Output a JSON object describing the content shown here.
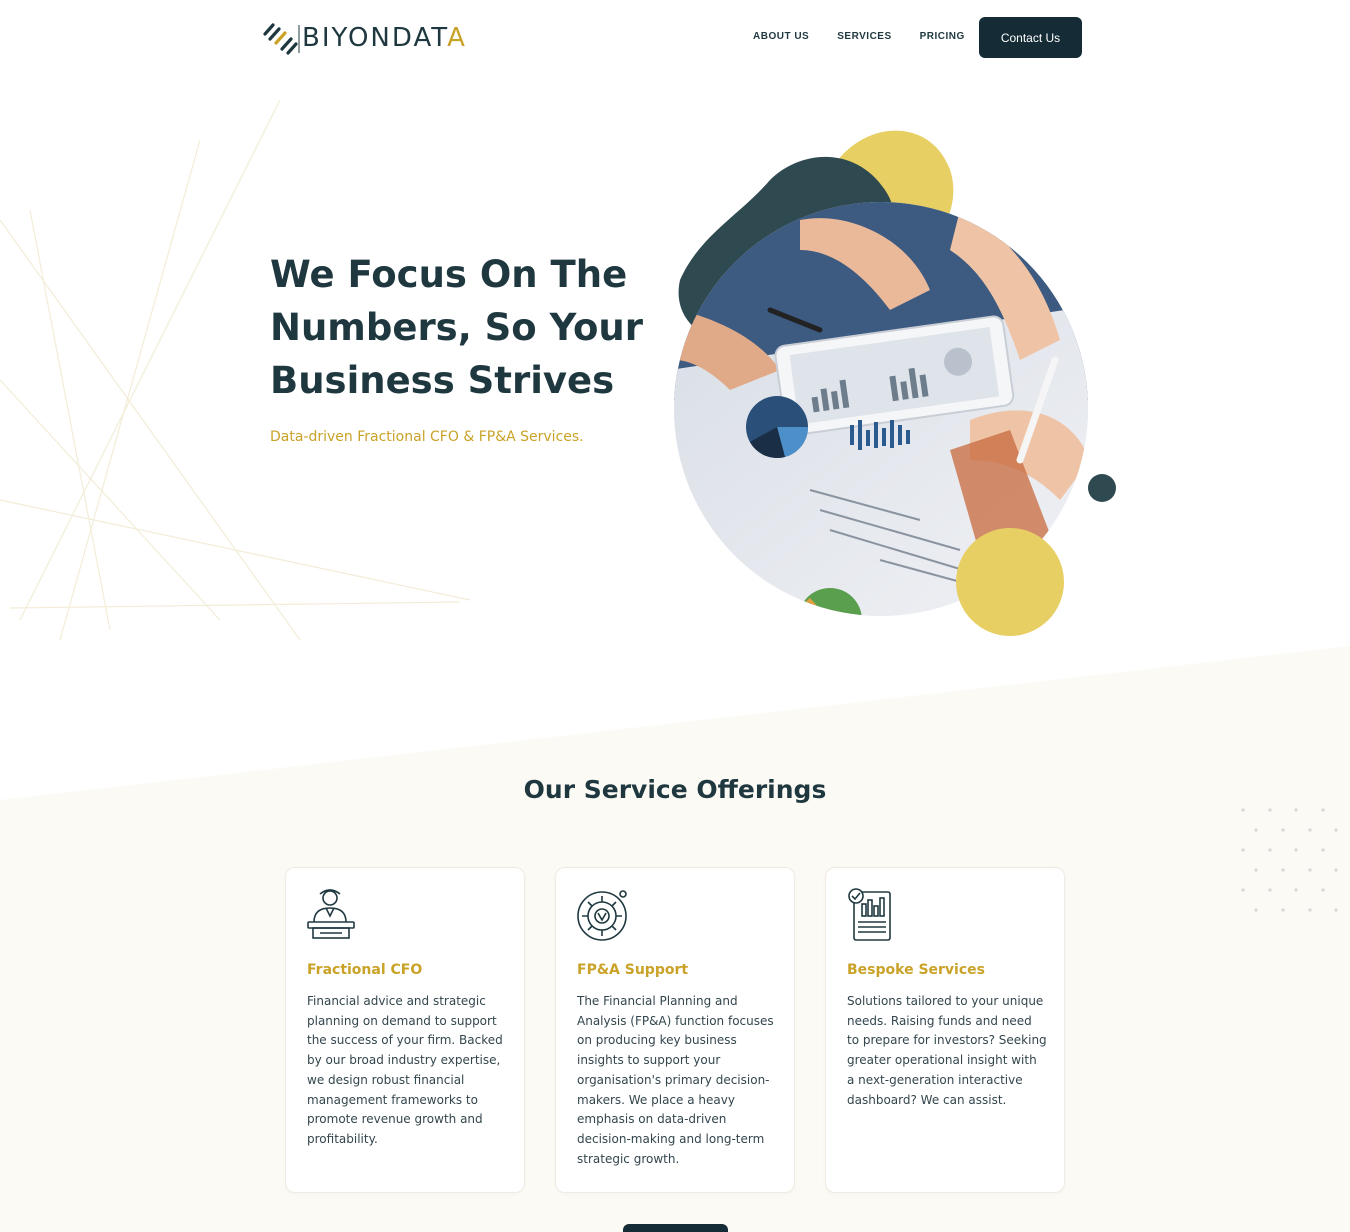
{
  "header": {
    "logo_text": "BIYONDATA",
    "nav": [
      "ABOUT US",
      "SERVICES",
      "PRICING"
    ],
    "contact_label": "Contact Us"
  },
  "hero": {
    "title_lines": [
      "We Focus On The",
      "Numbers, So Your",
      "Business Strives"
    ],
    "subtitle": "Data-driven Fractional CFO & FP&A Services."
  },
  "offerings": {
    "title": "Our Service Offerings",
    "cards": [
      {
        "icon": "presenter-icon",
        "title": "Fractional CFO",
        "desc": "Financial advice and strategic planning on demand to support the success of your firm. Backed by our broad industry expertise, we design robust financial management frameworks to promote revenue growth and profitability."
      },
      {
        "icon": "gear-icon",
        "title": "FP&A Support",
        "desc": "The Financial Planning and Analysis (FP&A) function focuses on producing key business insights to support your organisation's primary decision-makers. We place a heavy emphasis on data-driven decision-making and long-term strategic growth."
      },
      {
        "icon": "report-icon",
        "title": "Bespoke Services",
        "desc": "Solutions tailored to your unique needs. Raising funds and need to prepare for investors? Seeking greater operational insight with a next-generation interactive dashboard? We can assist."
      }
    ]
  },
  "colors": {
    "navy": "#1f3840",
    "dark_button": "#152c36",
    "gold": "#c9a227",
    "yellow_blob": "#e8cf63",
    "cream_band": "#fcfaf4"
  }
}
